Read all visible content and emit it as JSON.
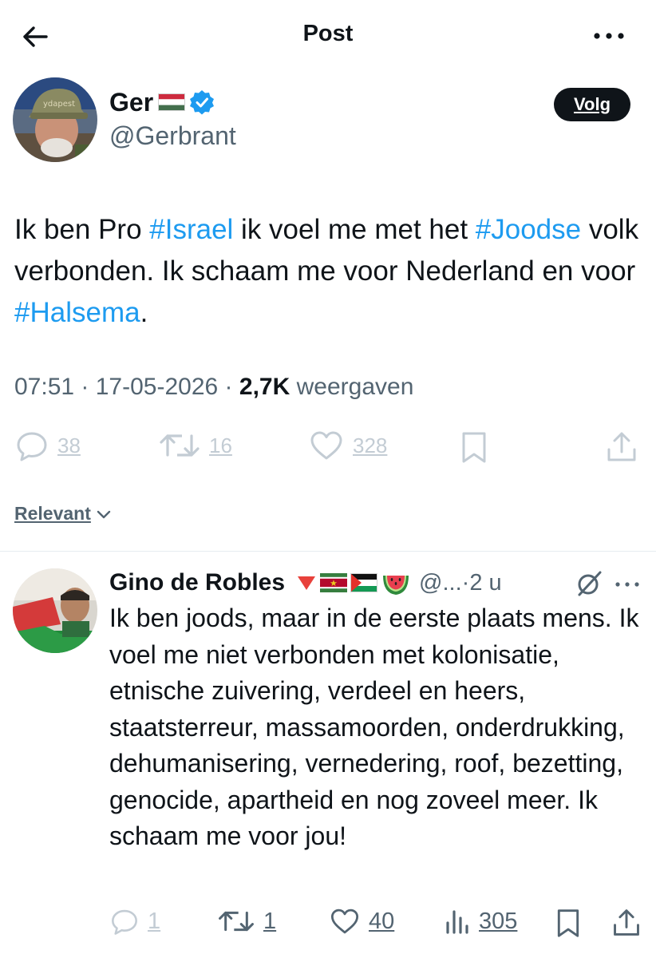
{
  "header": {
    "title": "Post"
  },
  "post": {
    "author_name": "Ger",
    "author_handle": "@Gerbrant",
    "follow_label": "Volg",
    "text": {
      "p1": "Ik ben Pro ",
      "h1": "#Israel",
      "p2": " ik voel me met het ",
      "h2": "#Joodse",
      "p3": " volk verbonden. Ik schaam me voor Nederland en voor ",
      "h3": "#Halsema",
      "p4": "."
    },
    "time": "07:51",
    "date": "17-05-2026",
    "views": "2,7K",
    "views_label": "weergaven",
    "replies": "38",
    "reposts": "16",
    "likes": "328"
  },
  "sort": {
    "label": "Relevant"
  },
  "reply": {
    "author_name": "Gino de Robles",
    "handle": "@...",
    "time": "2 u",
    "text": "Ik ben joods, maar in de eerste plaats mens. Ik voel me niet verbonden met kolonisatie, etnische zuivering, verdeel en heers, staatsterreur, massamoorden, onderdrukking, dehumanisering, vernedering, roof, bezetting, genocide, apartheid en nog zoveel meer. Ik schaam me voor jou!",
    "replies": "1",
    "reposts": "1",
    "likes": "40",
    "views": "305"
  },
  "colors": {
    "accent": "#1d9bf0",
    "text": "#0f1419",
    "secondary": "#536471",
    "muted": "#c3ccd4"
  },
  "icons": [
    "back-arrow-icon",
    "more-icon",
    "verified-icon",
    "reply-icon",
    "repost-icon",
    "like-icon",
    "bookmark-icon",
    "share-icon",
    "chevron-down-icon",
    "views-icon",
    "grok-icon"
  ]
}
